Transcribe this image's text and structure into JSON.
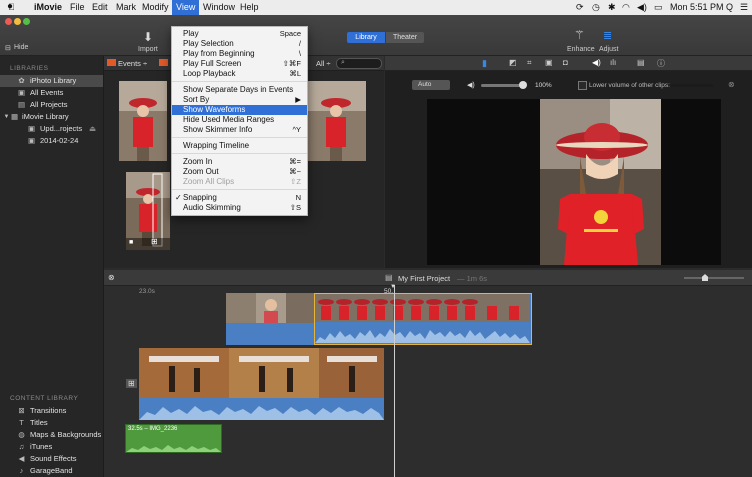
{
  "menubar": {
    "app_name": "iMovie",
    "items": [
      "File",
      "Edit",
      "Mark",
      "Modify",
      "View",
      "Window",
      "Help"
    ],
    "clock": "Mon 5:51 PM",
    "search_glyph": "Q"
  },
  "toolbar": {
    "hide_label": "Hide",
    "import_label": "Import",
    "import_glyph": "⬇",
    "tabs": [
      "Library",
      "Theater"
    ],
    "enhance_label": "Enhance",
    "adjust_label": "Adjust"
  },
  "sidebar": {
    "libraries_heading": "LIBRARIES",
    "libraries": [
      {
        "label": "iPhoto Library",
        "icon": "photo-library-icon",
        "selected": true
      },
      {
        "label": "All Events",
        "icon": "events-icon"
      },
      {
        "label": "All Projects",
        "icon": "projects-icon"
      },
      {
        "label": "iMovie Library",
        "icon": "library-icon"
      },
      {
        "label": "Upd...rojects",
        "icon": "event-icon"
      },
      {
        "label": "2014-02-24",
        "icon": "event-icon"
      }
    ],
    "content_heading": "CONTENT LIBRARY",
    "content": [
      {
        "label": "Transitions",
        "icon": "transitions-icon"
      },
      {
        "label": "Titles",
        "icon": "titles-icon"
      },
      {
        "label": "Maps & Backgrounds",
        "icon": "globe-icon"
      },
      {
        "label": "iTunes",
        "icon": "music-note-icon"
      },
      {
        "label": "Sound Effects",
        "icon": "speaker-icon"
      },
      {
        "label": "GarageBand",
        "icon": "guitar-icon"
      }
    ]
  },
  "browser": {
    "events_label": "Events ÷",
    "filter_label": "All ÷"
  },
  "viewer": {
    "auto_label": "Auto",
    "volume_percent": "100%",
    "volume_level": 1.0,
    "lower_volume_label": "Lower volume of other clips:"
  },
  "timeline": {
    "project_name": "My First Project",
    "project_duration": "— 1m 6s",
    "time_left": "23.0s",
    "time_mid": "50.",
    "audio_clip_label": "32.5s – IMG_2236"
  },
  "view_menu": {
    "items": [
      {
        "label": "Play",
        "shortcut": "Space"
      },
      {
        "label": "Play Selection",
        "shortcut": "/"
      },
      {
        "label": "Play from Beginning",
        "shortcut": "\\"
      },
      {
        "label": "Play Full Screen",
        "shortcut": "⇧⌘F"
      },
      {
        "label": "Loop Playback",
        "shortcut": "⌘L"
      },
      {
        "label": "Show Separate Days in Events",
        "shortcut": ""
      },
      {
        "label": "Sort By",
        "shortcut": "▶"
      },
      {
        "label": "Show Waveforms",
        "shortcut": "",
        "highlighted": true
      },
      {
        "label": "Hide Used Media Ranges",
        "shortcut": ""
      },
      {
        "label": "Show Skimmer Info",
        "shortcut": "^Y"
      },
      {
        "label": "Wrapping Timeline",
        "shortcut": ""
      },
      {
        "label": "Zoom In",
        "shortcut": "⌘="
      },
      {
        "label": "Zoom Out",
        "shortcut": "⌘−"
      },
      {
        "label": "Zoom All Clips",
        "shortcut": "⇧Z",
        "disabled": true
      },
      {
        "label": "Snapping",
        "shortcut": "N",
        "checked": true
      },
      {
        "label": "Audio Skimming",
        "shortcut": "⇧S"
      }
    ]
  },
  "colors": {
    "accent": "#2f6fd6",
    "video_clip_audio": "#4a7fc4",
    "audio_clip": "#4f9a3d",
    "selection": "#e6b43a"
  }
}
